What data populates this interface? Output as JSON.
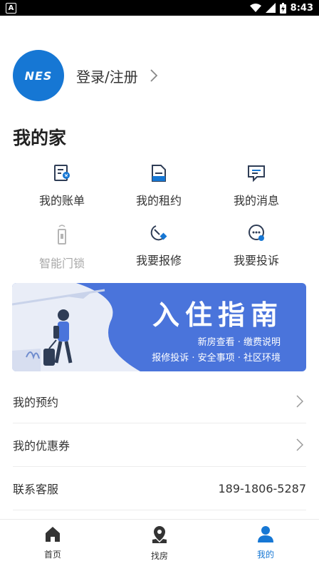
{
  "status_bar": {
    "time": "8:43",
    "app_badge": "A"
  },
  "profile": {
    "avatar_text": "NES",
    "login_label": "登录/注册"
  },
  "home": {
    "title": "我的家",
    "items": [
      {
        "label": "我的账单",
        "icon": "bill-icon",
        "enabled": true
      },
      {
        "label": "我的租约",
        "icon": "lease-icon",
        "enabled": true
      },
      {
        "label": "我的消息",
        "icon": "message-icon",
        "enabled": true
      },
      {
        "label": "智能门锁",
        "icon": "smart-lock-icon",
        "enabled": false
      },
      {
        "label": "我要报修",
        "icon": "repair-icon",
        "enabled": true
      },
      {
        "label": "我要投诉",
        "icon": "complaint-icon",
        "enabled": true
      }
    ]
  },
  "banner": {
    "title": "入住指南",
    "line1": "新房查看 · 缴费说明",
    "line2": "报修投诉 · 安全事项 · 社区环境"
  },
  "list": {
    "appointments": "我的预约",
    "coupons": "我的优惠券",
    "service_label": "联系客服",
    "service_phone": "189-1806-5287"
  },
  "tabbar": {
    "home": "首页",
    "find": "找房",
    "mine": "我的",
    "active": "mine"
  },
  "colors": {
    "accent": "#1677d4",
    "banner": "#4a74db",
    "icon_dark": "#2f3d56"
  }
}
